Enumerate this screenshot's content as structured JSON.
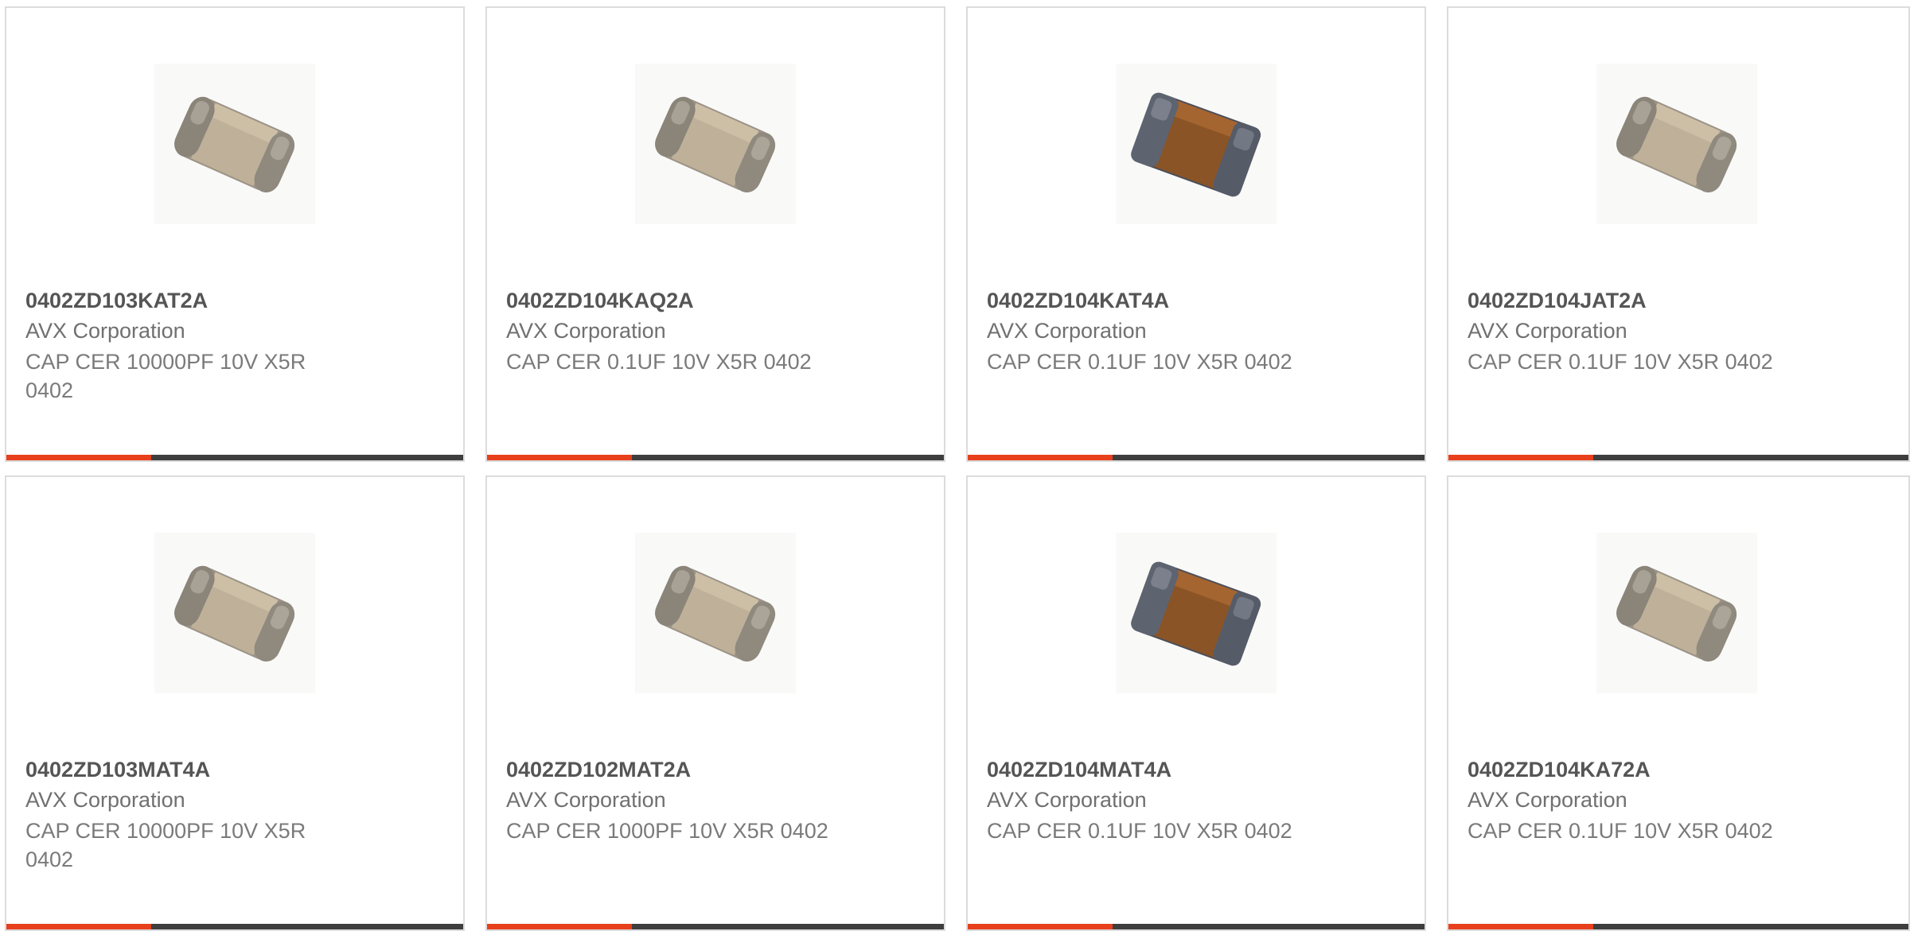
{
  "accent_color": "#e8401c",
  "bar_color": "#3e3e3e",
  "products": [
    {
      "part_number": "0402ZD103KAT2A",
      "manufacturer": "AVX Corporation",
      "description": "CAP CER 10000PF 10V X5R 0402",
      "image": "tan-ceramic-chip-capacitor"
    },
    {
      "part_number": "0402ZD104KAQ2A",
      "manufacturer": "AVX Corporation",
      "description": "CAP CER 0.1UF 10V X5R 0402",
      "image": "tan-ceramic-chip-capacitor"
    },
    {
      "part_number": "0402ZD104KAT4A",
      "manufacturer": "AVX Corporation",
      "description": "CAP CER 0.1UF 10V X5R 0402",
      "image": "brown-ceramic-chip-capacitor"
    },
    {
      "part_number": "0402ZD104JAT2A",
      "manufacturer": "AVX Corporation",
      "description": "CAP CER 0.1UF 10V X5R 0402",
      "image": "tan-ceramic-chip-capacitor"
    },
    {
      "part_number": "0402ZD103MAT4A",
      "manufacturer": "AVX Corporation",
      "description": "CAP CER 10000PF 10V X5R 0402",
      "image": "tan-ceramic-chip-capacitor"
    },
    {
      "part_number": "0402ZD102MAT2A",
      "manufacturer": "AVX Corporation",
      "description": "CAP CER 1000PF 10V X5R 0402",
      "image": "tan-ceramic-chip-capacitor"
    },
    {
      "part_number": "0402ZD104MAT4A",
      "manufacturer": "AVX Corporation",
      "description": "CAP CER 0.1UF 10V X5R 0402",
      "image": "brown-ceramic-chip-capacitor"
    },
    {
      "part_number": "0402ZD104KA72A",
      "manufacturer": "AVX Corporation",
      "description": "CAP CER 0.1UF 10V X5R 0402",
      "image": "tan-ceramic-chip-capacitor"
    }
  ]
}
